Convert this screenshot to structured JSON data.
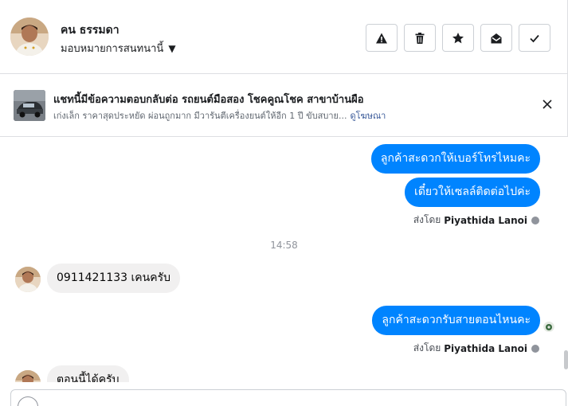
{
  "header": {
    "user_name": "คน ธรรมดา",
    "assign_label": "มอบหมายการสนทนานี้",
    "actions": [
      {
        "icon": "warning-icon"
      },
      {
        "icon": "trash-icon"
      },
      {
        "icon": "star-icon"
      },
      {
        "icon": "envelope-open-icon"
      },
      {
        "icon": "check-icon"
      }
    ]
  },
  "banner": {
    "title": "แชทนี้มีข้อความตอบกลับต่อ รถยนต์มือสอง โชคคูณโชค สาขาบ้านผือ",
    "subtitle": "เก่งเล็ก ราคาสุดประหยัด ผ่อนถูกมาก มีวารันตีเครื่องยนต์ให้อีก 1 ปี ขับสบาย...",
    "ad_link": "ดูโฆษณา"
  },
  "messages": {
    "out_1": "ลูกค้าสะดวกให้เบอร์โทรไหมคะ",
    "out_2": "เดี๋ยวให้เซลล์ติดต่อไปค่ะ",
    "sent_by_prefix": "ส่งโดย",
    "agent_name": "Piyathida Lanoi",
    "timestamp": "14:58",
    "in_1": "0911421133 เคนครับ",
    "out_3": "ลูกค้าสะดวกรับสายตอนไหนคะ",
    "in_2": "ตอนนี้ได้ครับ"
  },
  "colors": {
    "outgoing_bubble": "#0084ff",
    "incoming_bubble": "#f1f0f0",
    "link": "#385898"
  }
}
